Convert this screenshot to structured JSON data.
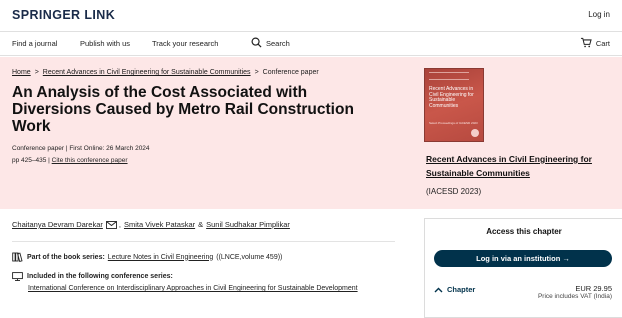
{
  "header": {
    "logo": "SPRINGER LINK",
    "login": "Log in"
  },
  "nav": {
    "find_journal": "Find a journal",
    "publish": "Publish with us",
    "track": "Track your research",
    "search": "Search",
    "cart": "Cart"
  },
  "breadcrumb": {
    "home": "Home",
    "book": "Recent Advances in Civil Engineering for Sustainable Communities",
    "current": "Conference paper"
  },
  "paper": {
    "title": "An Analysis of the Cost Associated with Diversions Caused by Metro Rail Construction Work",
    "type_line": "Conference paper | First Online: 26 March 2024",
    "pages": "pp 425–435",
    "cite": "Cite this conference paper"
  },
  "book": {
    "cover_text": "Recent Advances in Civil Engineering for Sustainable Communities",
    "cover_sub": "Select Proceedings of IACESD 2023",
    "title": "Recent Advances in Civil Engineering for Sustainable Communities",
    "abbr": "(IACESD 2023)"
  },
  "authors": {
    "a1": "Chaitanya Devram Darekar",
    "a2": "Smita Vivek Pataskar",
    "amp": "&",
    "a3": "Sunil Sudhakar Pimplikar"
  },
  "book_series": {
    "label": "Part of the book series:",
    "name": "Lecture Notes in Civil Engineering",
    "suffix": "((LNCE,volume 459))"
  },
  "conf_series": {
    "label": "Included in the following conference series:",
    "name": "International Conference on Interdisciplinary Approaches in Civil Engineering for Sustainable Development"
  },
  "access": {
    "title": "Access this chapter",
    "login_button": "Log in via an institution →",
    "chapter_label": "Chapter",
    "price": "EUR 29.95",
    "vat": "Price includes VAT (India)"
  },
  "colors": {
    "hero_bg": "#fde7e7",
    "brand_dark": "#01324b",
    "logo": "#1a2b49"
  }
}
